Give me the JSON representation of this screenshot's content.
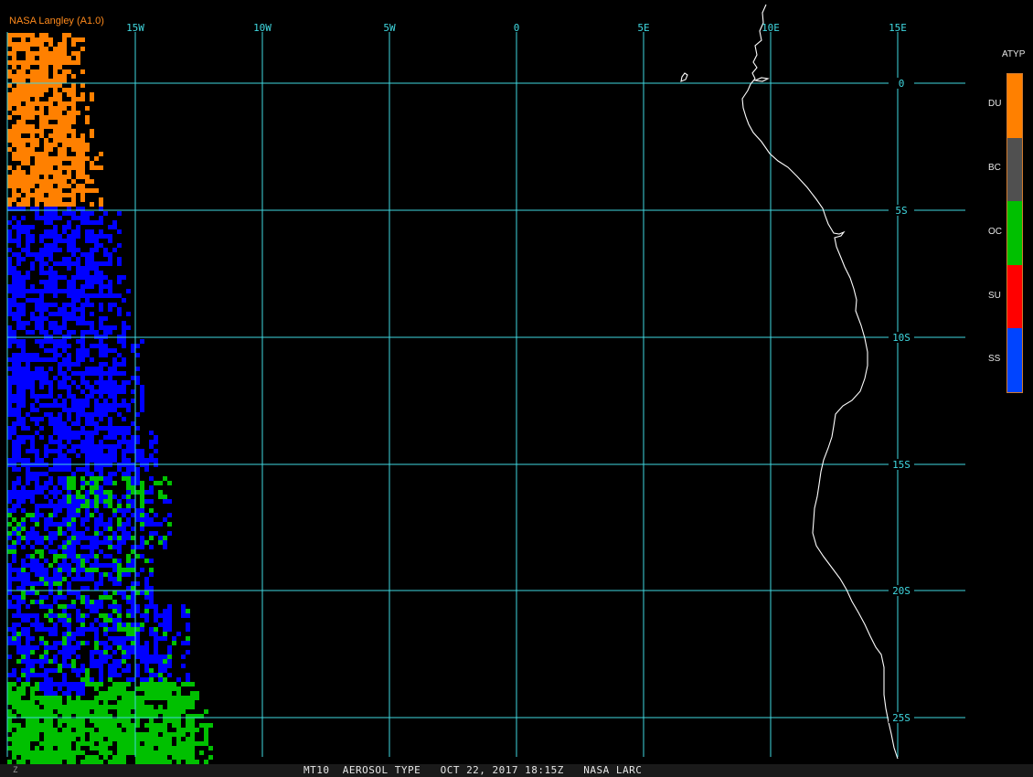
{
  "credit": "NASA Langley (A1.0)",
  "footer": {
    "text": "MT10  AEROSOL TYPE   OCT 22, 2017 18:15Z   NASA LARC",
    "mark": "Z"
  },
  "colors": {
    "grid": "#40d8e0",
    "coast": "#ffffff",
    "DU": "#ff8000",
    "BC": "#505050",
    "OC": "#00c000",
    "SU": "#ff0000",
    "SS": "#0044ff",
    "SS_swath": "#0000ff"
  },
  "longitude_labels": [
    "15W",
    "10W",
    "5W",
    "0",
    "5E",
    "10E",
    "15E"
  ],
  "latitude_labels": [
    "0",
    "5S",
    "10S",
    "15S",
    "20S",
    "25S"
  ],
  "legend": {
    "title": "ATYP",
    "items": [
      {
        "code": "DU",
        "color": "#ff8000"
      },
      {
        "code": "BC",
        "color": "#505050"
      },
      {
        "code": "OC",
        "color": "#00c000"
      },
      {
        "code": "SU",
        "color": "#ff0000"
      },
      {
        "code": "SS",
        "color": "#0044ff"
      }
    ]
  }
}
